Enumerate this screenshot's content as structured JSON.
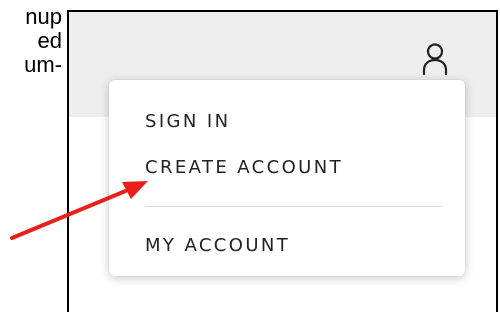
{
  "side_text": {
    "line1": "nup",
    "line2": "ed",
    "line3": "um-"
  },
  "header": {
    "account_icon": "user-icon"
  },
  "account_menu": {
    "items": [
      {
        "label": "SIGN IN"
      },
      {
        "label": "CREATE ACCOUNT"
      },
      {
        "label": "MY ACCOUNT"
      }
    ]
  },
  "annotation": {
    "arrow_color": "#e8201a",
    "target": "CREATE ACCOUNT"
  },
  "colors": {
    "header_background": "#eeeeee",
    "menu_background": "#ffffff",
    "menu_text": "#222222"
  }
}
